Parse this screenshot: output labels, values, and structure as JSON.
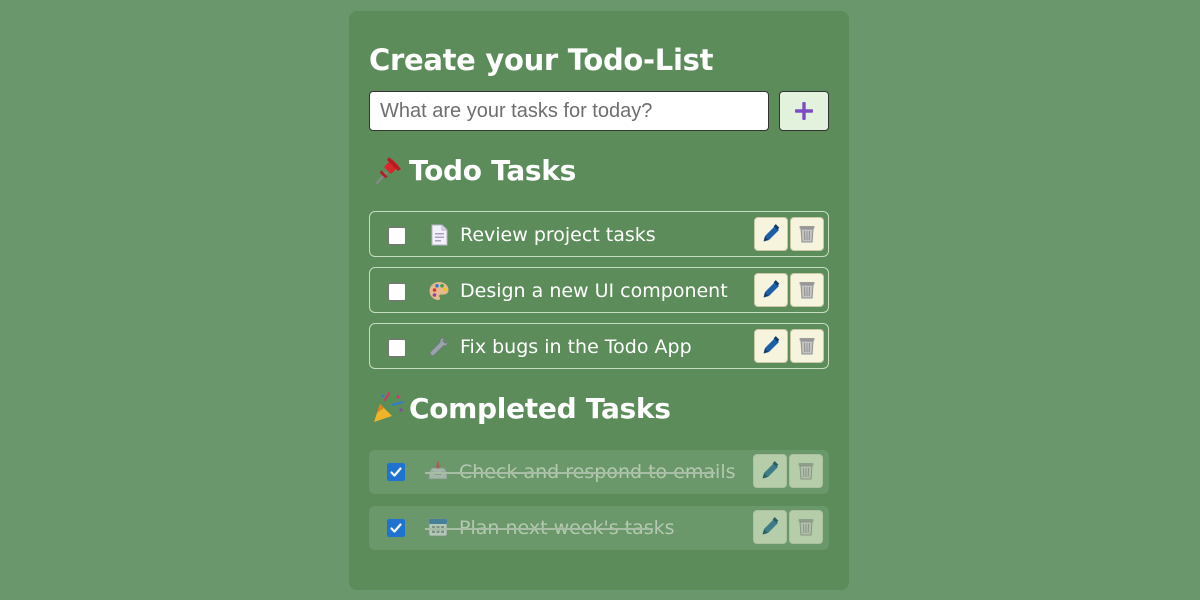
{
  "header": {
    "title": "Create your Todo-List"
  },
  "input": {
    "placeholder": "What are your tasks for today?",
    "value": "",
    "add_button_icon": "plus-icon"
  },
  "sections": {
    "todo_heading": "Todo Tasks",
    "todo_icon": "pushpin-icon",
    "completed_heading": "Completed Tasks",
    "completed_icon": "party-popper-icon"
  },
  "todo_tasks": [
    {
      "text": "Review project tasks",
      "icon": "page-facing-up-icon",
      "checked": false
    },
    {
      "text": "Design a new UI component",
      "icon": "artist-palette-icon",
      "checked": false
    },
    {
      "text": "Fix bugs in the Todo App",
      "icon": "wrench-icon",
      "checked": false
    }
  ],
  "completed_tasks": [
    {
      "text": "Check and respond to emails",
      "icon": "inbox-tray-icon",
      "checked": true
    },
    {
      "text": "Plan next week's tasks",
      "icon": "calendar-icon",
      "checked": true
    }
  ],
  "actions": {
    "edit_icon": "pen-icon",
    "delete_icon": "wastebasket-icon"
  },
  "colors": {
    "page_background": "#6b976c",
    "card_background": "#5b8c5a",
    "add_button_background": "#e3f2dd",
    "action_button_background": "#f7f4dd",
    "checkbox_checked": "#1f73d0",
    "plus_icon": "#7b4dc4",
    "pen_icon": "#1b5fa8"
  }
}
